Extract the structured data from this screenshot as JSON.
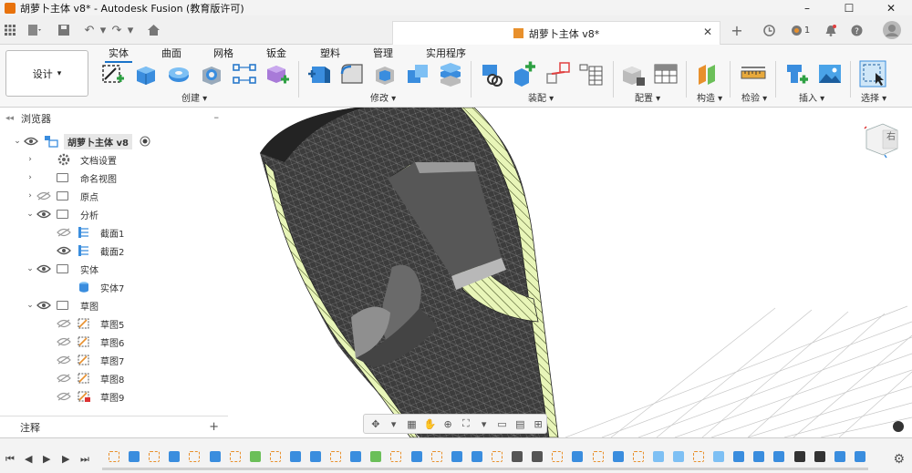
{
  "window": {
    "title": "胡萝卜主体 v8* - Autodesk Fusion (教育版许可)",
    "minimize": "–",
    "maximize": "☐",
    "close": "✕"
  },
  "tabbar": {
    "doc_title": "胡萝卜主体 v8*",
    "close": "✕",
    "add": "+",
    "notification_count": "1"
  },
  "workspace": {
    "label": "设计",
    "arrow": "▾"
  },
  "ribbon_tabs": [
    "实体",
    "曲面",
    "网格",
    "钣金",
    "塑料",
    "管理",
    "实用程序"
  ],
  "ribbon_groups": [
    "创建 ▾",
    "修改 ▾",
    "装配 ▾",
    "配置 ▾",
    "构造 ▾",
    "检验 ▾",
    "插入 ▾",
    "选择 ▾"
  ],
  "browser": {
    "title": "浏览器",
    "collapse": "–",
    "root": "胡萝卜主体 v8",
    "items": [
      {
        "label": "文档设置"
      },
      {
        "label": "命名视图"
      },
      {
        "label": "原点"
      },
      {
        "label": "分析"
      },
      {
        "label": "截面1"
      },
      {
        "label": "截面2"
      },
      {
        "label": "实体"
      },
      {
        "label": "实体7"
      },
      {
        "label": "草图"
      },
      {
        "label": "草图5"
      },
      {
        "label": "草图6"
      },
      {
        "label": "草图7"
      },
      {
        "label": "草图8"
      },
      {
        "label": "草图9"
      }
    ],
    "notes": "注释",
    "notes_add": "+"
  },
  "viewcube": {
    "face": "右"
  },
  "colors": {
    "accent": "#1a73c9",
    "section_fill": "#e8f5b8",
    "mesh_dark": "#3a3a3a",
    "brand_orange": "#e8720c"
  }
}
